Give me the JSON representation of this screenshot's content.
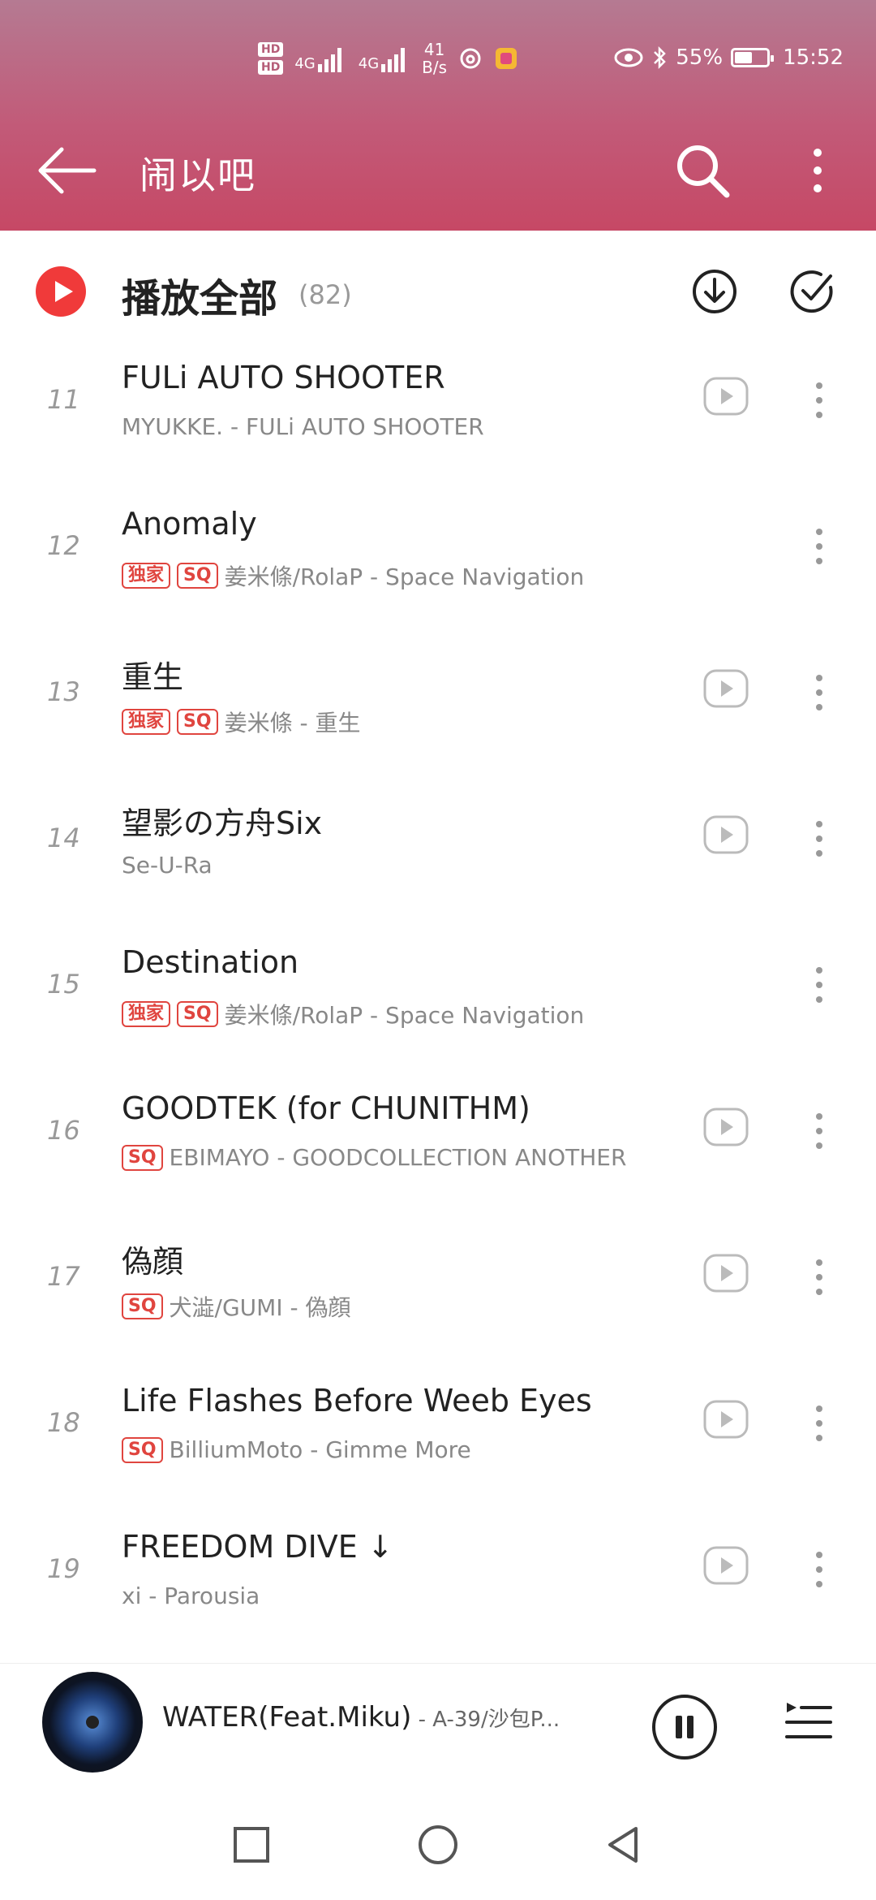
{
  "status_bar": {
    "hd1": "HD",
    "hd2": "HD",
    "signal1": "4G",
    "signal2": "4G",
    "net_speed_value": "41",
    "net_speed_unit": "B/s",
    "battery_percent": "55%",
    "battery_level": 0.55,
    "time": "15:52"
  },
  "appbar": {
    "title": "闹以吧"
  },
  "play_all": {
    "label": "播放全部",
    "count": "(82)"
  },
  "songs": [
    {
      "num": "11",
      "title": "FULi AUTO SHOOTER",
      "tags": [],
      "subtitle": "MYUKKE. - FULi AUTO SHOOTER",
      "has_play": true
    },
    {
      "num": "12",
      "title": "Anomaly",
      "tags": [
        "独家",
        "SQ"
      ],
      "subtitle": "姜米條/RolaP - Space Navigation",
      "has_play": false
    },
    {
      "num": "13",
      "title": "重生",
      "tags": [
        "独家",
        "SQ"
      ],
      "subtitle": "姜米條 - 重生",
      "has_play": true
    },
    {
      "num": "14",
      "title": "望影の方舟Six",
      "tags": [],
      "subtitle": "Se-U-Ra",
      "has_play": true
    },
    {
      "num": "15",
      "title": "Destination",
      "tags": [
        "独家",
        "SQ"
      ],
      "subtitle": "姜米條/RolaP - Space Navigation",
      "has_play": false
    },
    {
      "num": "16",
      "title": "GOODTEK (for CHUNITHM)",
      "tags": [
        "SQ"
      ],
      "subtitle": "EBIMAYO - GOODCOLLECTION ANOTHER",
      "has_play": true
    },
    {
      "num": "17",
      "title": "偽顔",
      "tags": [
        "SQ"
      ],
      "subtitle": "犬澁/GUMI - 偽顔",
      "has_play": true
    },
    {
      "num": "18",
      "title": "Life Flashes Before Weeb Eyes",
      "tags": [
        "SQ"
      ],
      "subtitle": "BilliumMoto - Gimme More",
      "has_play": true
    },
    {
      "num": "19",
      "title": "FREEDOM DIVE ↓",
      "tags": [],
      "subtitle": "xi - Parousia",
      "has_play": true
    }
  ],
  "now_playing": {
    "title": "WATER(Feat.Miku)",
    "artist": " - A-39/沙包P..."
  },
  "colors": {
    "header_top": "#b57a92",
    "header_bottom": "#c64865",
    "accent_red": "#f03a3a",
    "tag_red": "#e0453f"
  }
}
